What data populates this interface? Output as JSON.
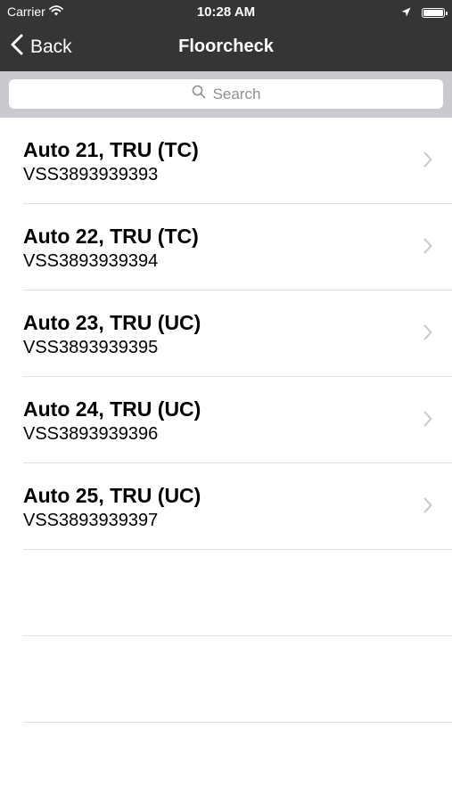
{
  "status_bar": {
    "carrier": "Carrier",
    "time": "10:28 AM"
  },
  "nav": {
    "back_label": "Back",
    "title": "Floorcheck"
  },
  "search": {
    "placeholder": "Search"
  },
  "items": [
    {
      "title": "Auto 21, TRU (TC)",
      "subtitle": "VSS3893939393"
    },
    {
      "title": "Auto 22, TRU (TC)",
      "subtitle": "VSS3893939394"
    },
    {
      "title": "Auto 23, TRU (UC)",
      "subtitle": "VSS3893939395"
    },
    {
      "title": "Auto 24, TRU (UC)",
      "subtitle": "VSS3893939396"
    },
    {
      "title": "Auto 25, TRU (UC)",
      "subtitle": "VSS3893939397"
    }
  ],
  "colors": {
    "nav_background": "#353535",
    "search_background": "#c9c9ce",
    "separator": "#e1e1e4"
  },
  "icons": [
    "wifi-icon",
    "location-arrow-icon",
    "battery-icon",
    "chevron-left-icon",
    "search-icon",
    "chevron-right-icon"
  ]
}
